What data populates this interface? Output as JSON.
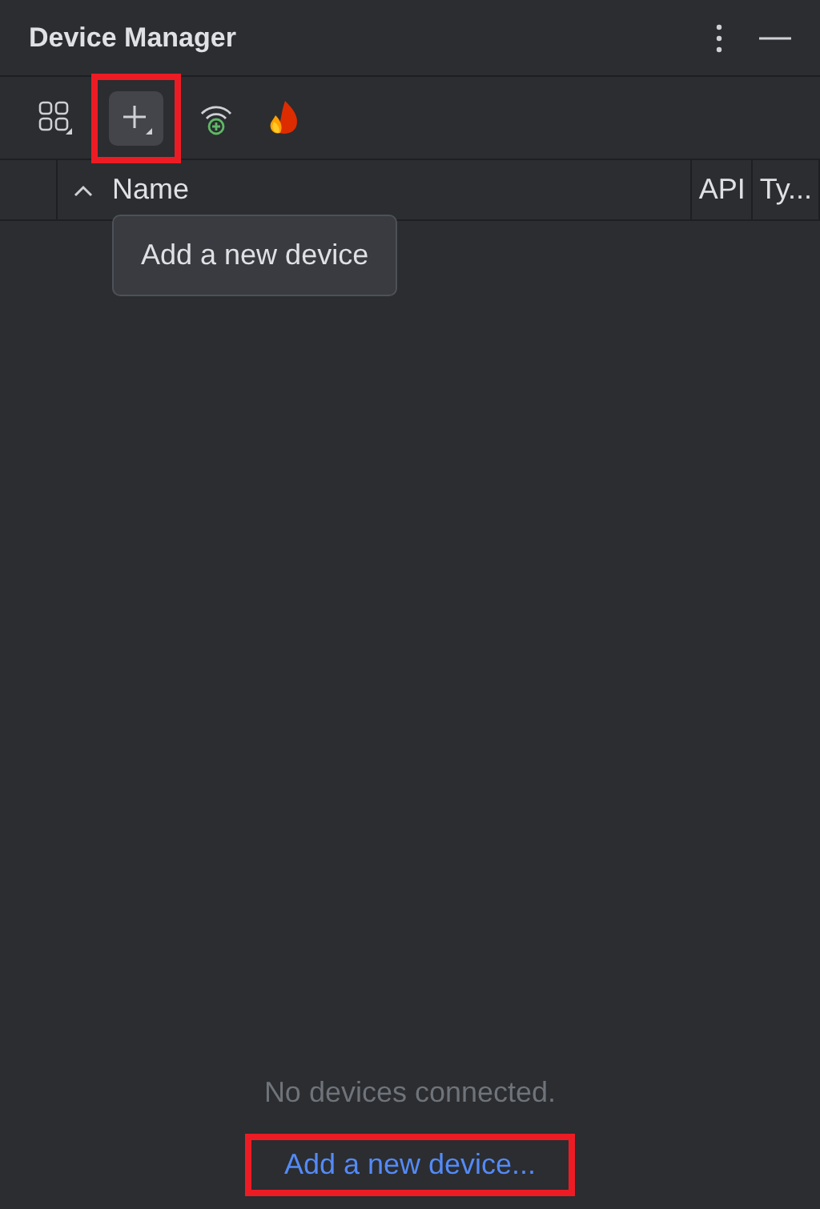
{
  "window": {
    "title": "Device Manager"
  },
  "toolbar": [
    {
      "kind": "grid",
      "highlighted": false,
      "hovered": false
    },
    {
      "kind": "add",
      "highlighted": true,
      "hovered": true
    },
    {
      "kind": "wifi",
      "highlighted": false,
      "hovered": false
    },
    {
      "kind": "flame",
      "highlighted": false,
      "hovered": false
    }
  ],
  "table": {
    "columns": [
      {
        "label": "Name",
        "sorted": true
      },
      {
        "label": "API",
        "sorted": false
      },
      {
        "label": "Ty...",
        "sorted": false
      }
    ]
  },
  "tooltip": {
    "text": "Add a new device"
  },
  "empty_state": {
    "message": "No devices connected.",
    "link": {
      "text": "Add a new device...",
      "highlighted": true
    }
  }
}
